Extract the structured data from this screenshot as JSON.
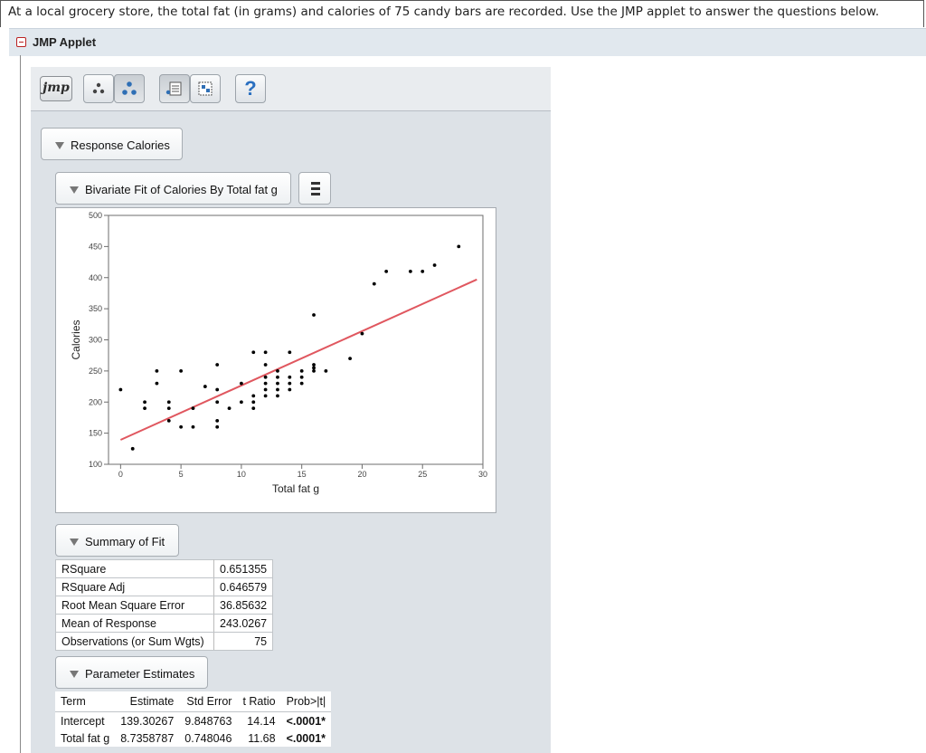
{
  "question": "At a local grocery store, the total fat (in grams) and calories of 75 candy bars are recorded. Use the JMP applet to answer the questions below.",
  "applet": {
    "title": "JMP Applet",
    "logo": "jmp"
  },
  "toolbar": {
    "help_label": "?",
    "icons": [
      "jmp-logo",
      "small-points-icon",
      "large-points-icon",
      "report-icon",
      "grid-icon",
      "help-icon"
    ]
  },
  "outline": {
    "response": "Response Calories",
    "bivariate": "Bivariate Fit of Calories By Total fat g",
    "summary": "Summary of Fit",
    "params": "Parameter Estimates"
  },
  "chart_data": {
    "type": "scatter",
    "xlabel": "Total fat g",
    "ylabel": "Calories",
    "xlim": [
      -1,
      30
    ],
    "ylim": [
      100,
      500
    ],
    "xticks": [
      0,
      5,
      10,
      15,
      20,
      25,
      30
    ],
    "yticks": [
      100,
      150,
      200,
      250,
      300,
      350,
      400,
      450,
      500
    ],
    "grid": false,
    "points": [
      [
        0,
        220
      ],
      [
        1,
        125
      ],
      [
        2,
        190
      ],
      [
        2,
        200
      ],
      [
        3,
        250
      ],
      [
        3,
        230
      ],
      [
        4,
        200
      ],
      [
        4,
        190
      ],
      [
        4,
        170
      ],
      [
        5,
        250
      ],
      [
        5,
        160
      ],
      [
        6,
        160
      ],
      [
        6,
        190
      ],
      [
        7,
        225
      ],
      [
        8,
        260
      ],
      [
        8,
        220
      ],
      [
        8,
        200
      ],
      [
        8,
        170
      ],
      [
        8,
        160
      ],
      [
        9,
        190
      ],
      [
        10,
        230
      ],
      [
        10,
        200
      ],
      [
        11,
        280
      ],
      [
        11,
        210
      ],
      [
        11,
        200
      ],
      [
        11,
        190
      ],
      [
        12,
        280
      ],
      [
        12,
        260
      ],
      [
        12,
        240
      ],
      [
        12,
        230
      ],
      [
        12,
        220
      ],
      [
        12,
        210
      ],
      [
        13,
        240
      ],
      [
        13,
        230
      ],
      [
        13,
        220
      ],
      [
        13,
        210
      ],
      [
        13,
        250
      ],
      [
        14,
        280
      ],
      [
        14,
        240
      ],
      [
        14,
        230
      ],
      [
        14,
        220
      ],
      [
        15,
        250
      ],
      [
        15,
        240
      ],
      [
        15,
        230
      ],
      [
        16,
        340
      ],
      [
        16,
        260
      ],
      [
        16,
        255
      ],
      [
        16,
        250
      ],
      [
        17,
        250
      ],
      [
        19,
        270
      ],
      [
        20,
        310
      ],
      [
        21,
        390
      ],
      [
        22,
        410
      ],
      [
        24,
        410
      ],
      [
        25,
        410
      ],
      [
        26,
        420
      ],
      [
        28,
        450
      ]
    ],
    "fit_line": {
      "intercept": 139.30267,
      "slope": 8.7358787,
      "x_range": [
        0,
        29.5
      ],
      "color": "#e0575f"
    }
  },
  "summary_of_fit": [
    {
      "label": "RSquare",
      "value": "0.651355"
    },
    {
      "label": "RSquare Adj",
      "value": "0.646579"
    },
    {
      "label": "Root Mean Square Error",
      "value": "36.85632"
    },
    {
      "label": "Mean of Response",
      "value": "243.0267"
    },
    {
      "label": "Observations (or Sum Wgts)",
      "value": "75"
    }
  ],
  "parameter_estimates": {
    "headers": [
      "Term",
      "Estimate",
      "Std Error",
      "t Ratio",
      "Prob>|t|"
    ],
    "rows": [
      [
        "Intercept",
        "139.30267",
        "9.848763",
        "14.14",
        "<.0001*"
      ],
      [
        "Total fat g",
        "8.7358787",
        "0.748046",
        "11.68",
        "<.0001*"
      ]
    ]
  }
}
